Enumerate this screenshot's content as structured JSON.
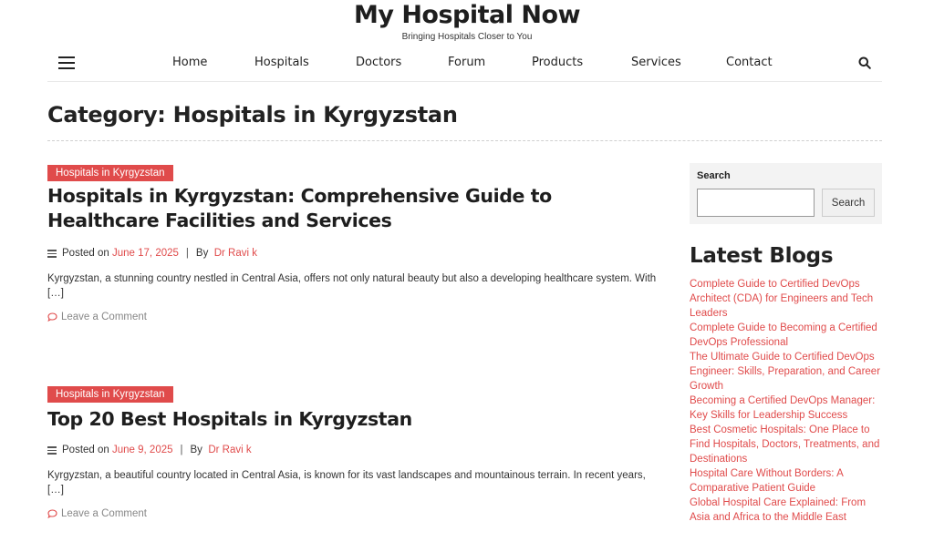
{
  "site": {
    "title": "My Hospital Now",
    "tagline": "Bringing Hospitals Closer to You"
  },
  "nav": {
    "items": [
      "Home",
      "Hospitals",
      "Doctors",
      "Forum",
      "Products",
      "Services",
      "Contact"
    ]
  },
  "category": {
    "title": "Category: Hospitals in Kyrgyzstan"
  },
  "posts": [
    {
      "badge": "Hospitals in Kyrgyzstan",
      "title": "Hospitals in Kyrgyzstan: Comprehensive Guide to Healthcare Facilities and Services",
      "posted_on": "Posted on",
      "date": "June 17, 2025",
      "sep": "|",
      "by": "By",
      "author": "Dr Ravi k",
      "excerpt": "Kyrgyzstan, a stunning country nestled in Central Asia, offers not only natural beauty but also a developing healthcare system. With […]",
      "comment": "Leave a Comment"
    },
    {
      "badge": "Hospitals in Kyrgyzstan",
      "title": "Top 20 Best Hospitals in Kyrgyzstan",
      "posted_on": "Posted on",
      "date": "June 9, 2025",
      "sep": "|",
      "by": "By",
      "author": "Dr Ravi k",
      "excerpt": "Kyrgyzstan, a beautiful country located in Central Asia, is known for its vast landscapes and mountainous terrain. In recent years, […]",
      "comment": "Leave a Comment"
    }
  ],
  "sidebar": {
    "search_label": "Search",
    "search_button": "Search",
    "latest_title": "Latest Blogs",
    "latest": [
      "Complete Guide to Certified DevOps Architect (CDA) for Engineers and Tech Leaders",
      "Complete Guide to Becoming a Certified DevOps Professional",
      "The Ultimate Guide to Certified DevOps Engineer: Skills, Preparation, and Career Growth",
      "Becoming a Certified DevOps Manager: Key Skills for Leadership Success",
      "Best Cosmetic Hospitals: One Place to Find Hospitals, Doctors, Treatments, and Destinations",
      "Hospital Care Without Borders: A Comparative Patient Guide",
      "Global Hospital Care Explained: From Asia and Africa to the Middle East"
    ]
  },
  "colors": {
    "accent": "#e04b4b",
    "text": "#222222",
    "muted": "#888888"
  },
  "icons": {
    "menu": "hamburger-menu-icon",
    "search": "search-icon",
    "meta": "list-lines-icon",
    "comment": "speech-bubble-icon"
  }
}
